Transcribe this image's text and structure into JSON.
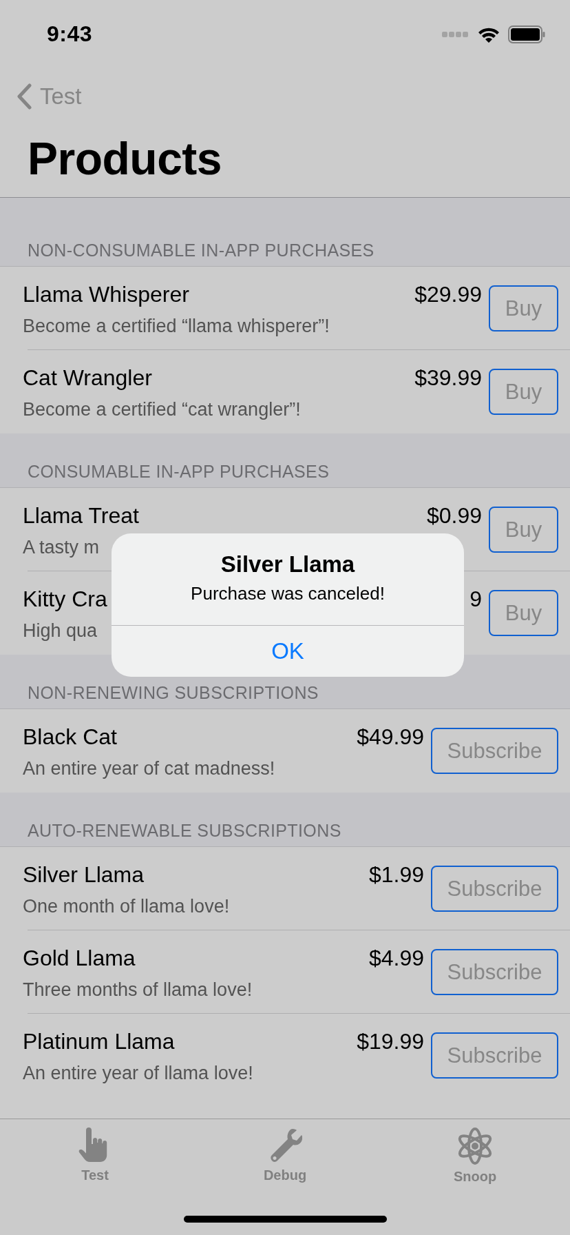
{
  "status_bar": {
    "time": "9:43"
  },
  "nav": {
    "back": "Test",
    "title": "Products"
  },
  "sections": [
    {
      "header": "NON-CONSUMABLE IN-APP PURCHASES",
      "items": [
        {
          "name": "Llama Whisperer",
          "description": "Become a certified “llama whisperer”!",
          "price": "$29.99",
          "action": "Buy"
        },
        {
          "name": "Cat Wrangler",
          "description": "Become a certified “cat wrangler”!",
          "price": "$39.99",
          "action": "Buy"
        }
      ]
    },
    {
      "header": "CONSUMABLE IN-APP PURCHASES",
      "items": [
        {
          "name": "Llama Treat",
          "description": "A tasty m",
          "price": "$0.99",
          "action": "Buy"
        },
        {
          "name": "Kitty Cra",
          "description": "High qua",
          "price": "9",
          "action": "Buy"
        }
      ]
    },
    {
      "header": "NON-RENEWING SUBSCRIPTIONS",
      "items": [
        {
          "name": "Black Cat",
          "description": "An entire year of cat madness!",
          "price": "$49.99",
          "action": "Subscribe"
        }
      ]
    },
    {
      "header": "AUTO-RENEWABLE SUBSCRIPTIONS",
      "items": [
        {
          "name": "Silver Llama",
          "description": "One month of llama love!",
          "price": "$1.99",
          "action": "Subscribe"
        },
        {
          "name": "Gold Llama",
          "description": "Three months of llama love!",
          "price": "$4.99",
          "action": "Subscribe"
        },
        {
          "name": "Platinum Llama",
          "description": "An entire year of llama love!",
          "price": "$19.99",
          "action": "Subscribe"
        }
      ]
    }
  ],
  "alert": {
    "title": "Silver Llama",
    "message": "Purchase was canceled!",
    "button": "OK"
  },
  "tab_bar": [
    {
      "label": "Test"
    },
    {
      "label": "Debug"
    },
    {
      "label": "Snoop"
    }
  ]
}
